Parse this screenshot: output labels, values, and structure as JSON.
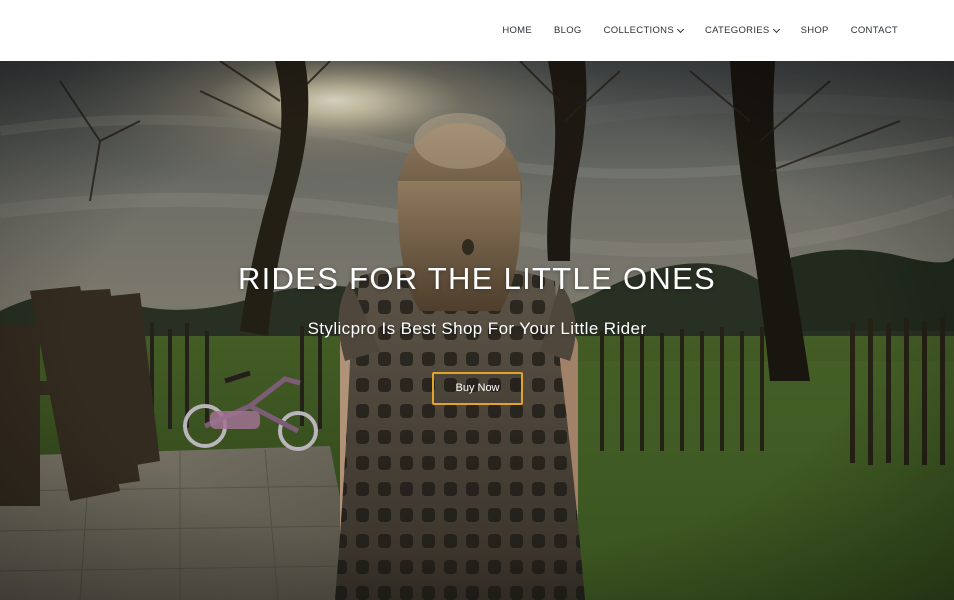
{
  "nav": {
    "items": [
      {
        "label": "HOME",
        "has_dropdown": false
      },
      {
        "label": "BLOG",
        "has_dropdown": false
      },
      {
        "label": "COLLECTIONS",
        "has_dropdown": true
      },
      {
        "label": "CATEGORIES",
        "has_dropdown": true
      },
      {
        "label": "SHOP",
        "has_dropdown": false
      },
      {
        "label": "CONTACT",
        "has_dropdown": false
      }
    ]
  },
  "hero": {
    "title": "RIDES FOR THE LITTLE ONES",
    "subtitle": "Stylicpro Is Best Shop For Your Little Rider",
    "button_label": "Buy Now"
  },
  "colors": {
    "accent": "#e3a326",
    "nav_text": "#2c3338",
    "header_bg": "#ffffff"
  }
}
